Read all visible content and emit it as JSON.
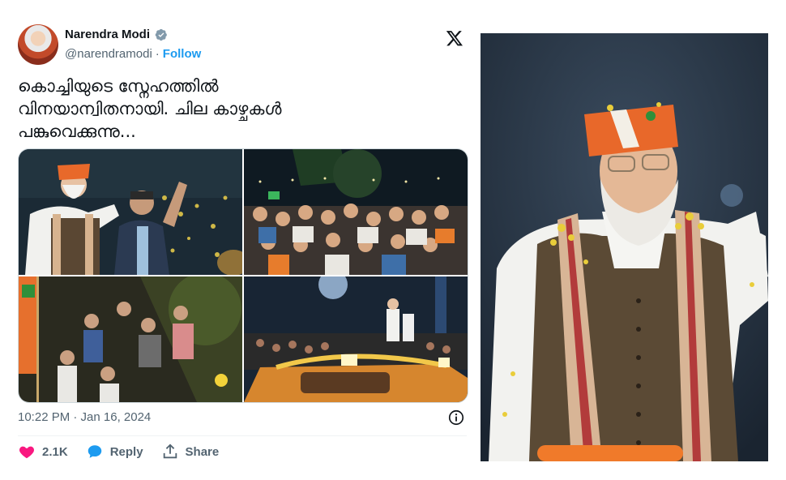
{
  "tweet": {
    "author_name": "Narendra Modi",
    "author_handle": "@narendramodi",
    "separator": "·",
    "follow_label": "Follow",
    "text": "കൊച്ചിയുടെ സ്നേഹത്തിൽ\nവിനയാന്വിതനായി. ചില കാഴ്ചകൾ\nപങ്കുവെക്കുന്നു...",
    "timestamp": "10:22 PM · Jan 16, 2024",
    "likes": "2.1K",
    "reply_label": "Reply",
    "share_label": "Share"
  },
  "icons": {
    "like": "heart-icon",
    "reply": "speech-bubble-icon",
    "share": "share-upload-icon",
    "info": "info-icon",
    "logo": "x-logo-icon",
    "verified": "verified-badge-icon"
  },
  "colors": {
    "accent": "#1d9bf0",
    "like": "#f91880",
    "text": "#0f1419",
    "muted": "#536471"
  }
}
